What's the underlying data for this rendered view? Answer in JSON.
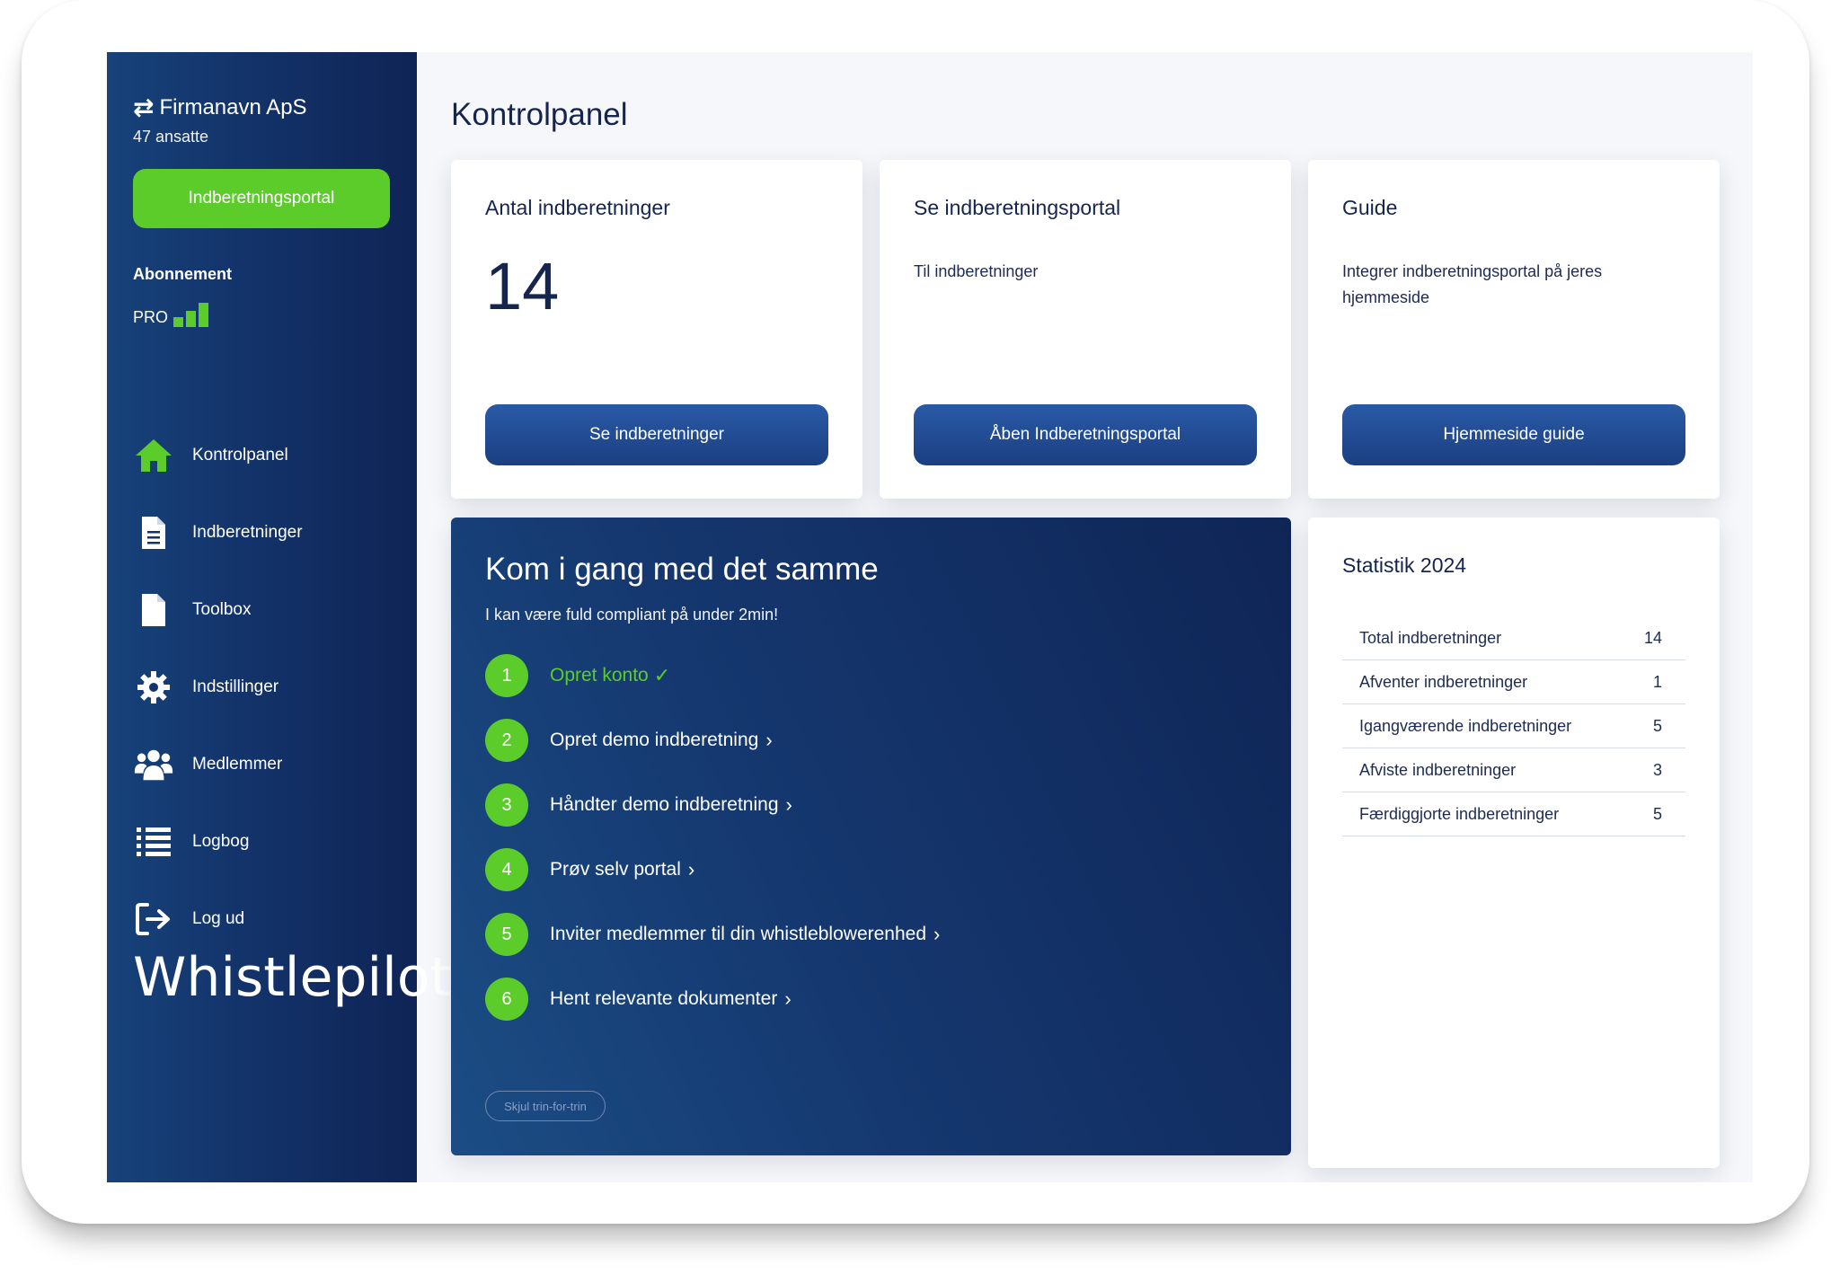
{
  "sidebar": {
    "company_name": "Firmanavn ApS",
    "employees": "47 ansatte",
    "portal_button": "Indberetningsportal",
    "subscription_label": "Abonnement",
    "plan": "PRO",
    "plan_level": 3,
    "items": [
      {
        "label": "Kontrolpanel",
        "icon": "home-icon",
        "active": true
      },
      {
        "label": "Indberetninger",
        "icon": "document-icon"
      },
      {
        "label": "Toolbox",
        "icon": "file-icon"
      },
      {
        "label": "Indstillinger",
        "icon": "gear-icon"
      },
      {
        "label": "Medlemmer",
        "icon": "users-icon"
      },
      {
        "label": "Logbog",
        "icon": "list-icon"
      },
      {
        "label": "Log ud",
        "icon": "logout-icon"
      }
    ],
    "logo_text": "Whistlepilot"
  },
  "main": {
    "title": "Kontrolpanel",
    "cards": [
      {
        "title": "Antal indberetninger",
        "value": "14",
        "button": "Se indberetninger"
      },
      {
        "title": "Se indberetningsportal",
        "text": "Til indberetninger",
        "button": "Åben Indberetningsportal"
      },
      {
        "title": "Guide",
        "text": "Integrer indberetningsportal på jeres hjemmeside",
        "button": "Hjemmeside guide"
      }
    ],
    "onboarding": {
      "title": "Kom i gang med det samme",
      "subtitle": "I kan være fuld compliant på under 2min!",
      "steps": [
        {
          "num": "1",
          "label": "Opret konto",
          "done": true
        },
        {
          "num": "2",
          "label": "Opret demo indberetning"
        },
        {
          "num": "3",
          "label": "Håndter demo indberetning"
        },
        {
          "num": "4",
          "label": "Prøv selv portal"
        },
        {
          "num": "5",
          "label": "Inviter medlemmer til din whistleblowerenhed"
        },
        {
          "num": "6",
          "label": "Hent relevante dokumenter"
        }
      ],
      "hide_button": "Skjul trin-for-trin"
    },
    "stats": {
      "title": "Statistik 2024",
      "rows": [
        {
          "label": "Total indberetninger",
          "value": "14"
        },
        {
          "label": "Afventer indberetninger",
          "value": "1"
        },
        {
          "label": "Igangværende indberetninger",
          "value": "5"
        },
        {
          "label": "Afviste indberetninger",
          "value": "3"
        },
        {
          "label": "Færdiggjorte indberetninger",
          "value": "5"
        }
      ]
    }
  },
  "colors": {
    "accent_green": "#5ccc2b",
    "navy": "#15254e",
    "button_blue": "#2a5aa6"
  }
}
